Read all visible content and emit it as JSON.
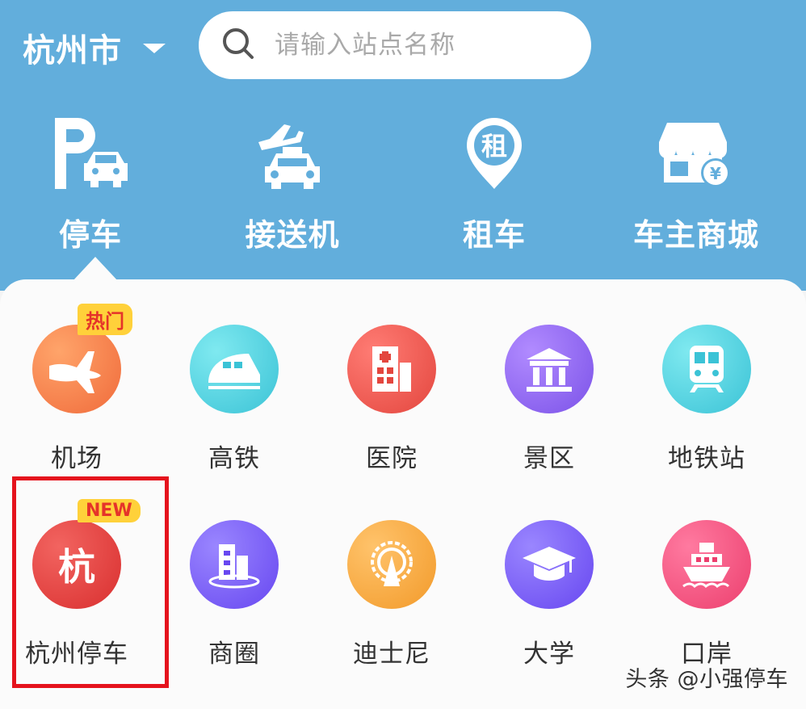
{
  "header": {
    "city": "杭州市",
    "search_placeholder": "请输入站点名称"
  },
  "nav": [
    {
      "label": "停车",
      "icon": "parking-car-icon"
    },
    {
      "label": "接送机",
      "icon": "airport-taxi-icon"
    },
    {
      "label": "租车",
      "icon": "rental-location-icon"
    },
    {
      "label": "车主商城",
      "icon": "shop-icon"
    }
  ],
  "categories": [
    {
      "label": "机场",
      "icon": "airplane-icon",
      "badge": "热门",
      "color": "#f06b3b"
    },
    {
      "label": "高铁",
      "icon": "high-speed-train-icon",
      "color": "#3bc3d6"
    },
    {
      "label": "医院",
      "icon": "hospital-icon",
      "color": "#e3463e"
    },
    {
      "label": "景区",
      "icon": "temple-icon",
      "color": "#7b52e8"
    },
    {
      "label": "地铁站",
      "icon": "subway-icon",
      "color": "#3bc3d6"
    },
    {
      "label": "杭州停车",
      "icon": "hangzhou-logo-icon",
      "icon_text": "杭",
      "badge": "NEW",
      "color": "#d92f2f"
    },
    {
      "label": "商圈",
      "icon": "business-district-icon",
      "color": "#6747f0"
    },
    {
      "label": "迪士尼",
      "icon": "disney-icon",
      "color": "#f29a2a"
    },
    {
      "label": "大学",
      "icon": "graduation-cap-icon",
      "color": "#6747f0"
    },
    {
      "label": "口岸",
      "icon": "ship-icon",
      "color": "#ec3f6e"
    }
  ],
  "watermark": "头条 @小强停车"
}
